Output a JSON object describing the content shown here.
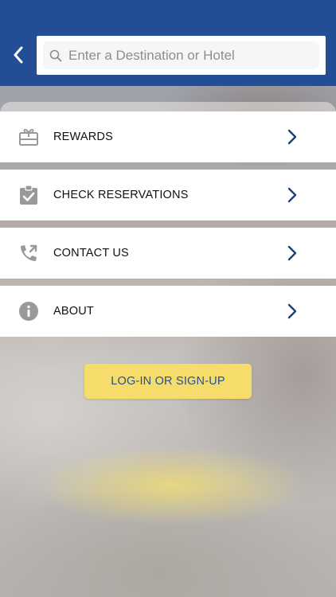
{
  "colors": {
    "header": "#234e95",
    "cta": "#f6dc6b",
    "cta_text": "#2a4f8a",
    "chevron": "#1f3f78",
    "icon": "#999999"
  },
  "header": {
    "back_icon": "chevron-left-icon",
    "search": {
      "icon": "search-icon",
      "placeholder": "Enter a Destination or Hotel",
      "value": ""
    }
  },
  "menu": {
    "items": [
      {
        "label": "REWARDS",
        "icon": "gift-card-icon"
      },
      {
        "label": "CHECK RESERVATIONS",
        "icon": "clipboard-check-icon"
      },
      {
        "label": "CONTACT US",
        "icon": "phone-forward-icon"
      },
      {
        "label": "ABOUT",
        "icon": "info-icon"
      }
    ]
  },
  "cta": {
    "label": "LOG-IN OR SIGN-UP"
  }
}
